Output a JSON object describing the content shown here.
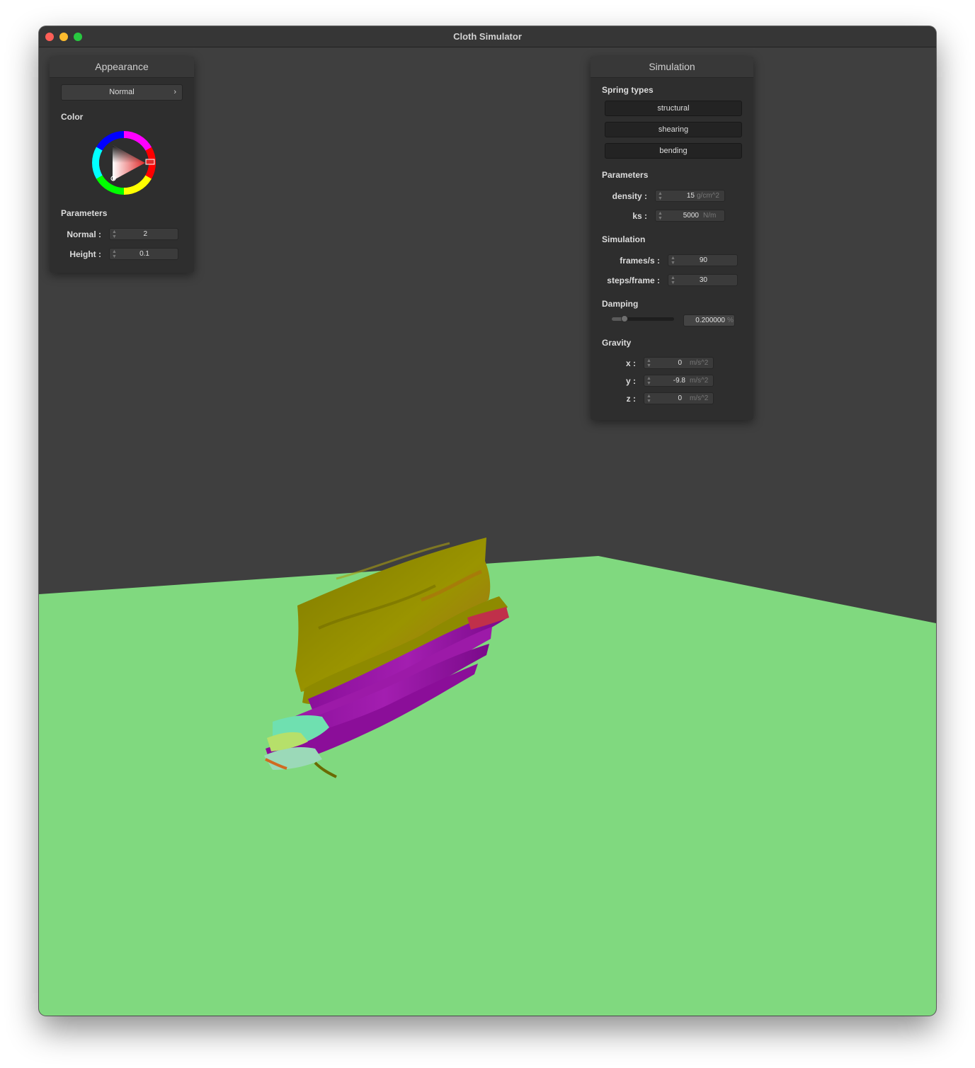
{
  "window": {
    "title": "Cloth Simulator"
  },
  "appearance": {
    "title": "Appearance",
    "shader": "Normal",
    "color_label": "Color",
    "selected_color": "#e02a2a",
    "params_label": "Parameters",
    "normal_label": "Normal :",
    "normal_value": "2",
    "height_label": "Height :",
    "height_value": "0.1"
  },
  "simulation": {
    "title": "Simulation",
    "spring_types_label": "Spring types",
    "spring_types": [
      "structural",
      "shearing",
      "bending"
    ],
    "params_label": "Parameters",
    "density_label": "density :",
    "density_value": "15",
    "density_unit": "g/cm^2",
    "ks_label": "ks :",
    "ks_value": "5000",
    "ks_unit": "N/m",
    "sim_label": "Simulation",
    "fps_label": "frames/s :",
    "fps_value": "90",
    "spf_label": "steps/frame :",
    "spf_value": "30",
    "damping_label": "Damping",
    "damping_value": "0.200000",
    "damping_unit": "%",
    "damping_slider_fraction": 0.2,
    "gravity_label": "Gravity",
    "gx_label": "x :",
    "gx_value": "0",
    "gy_label": "y :",
    "gy_value": "-9.8",
    "gz_label": "z :",
    "gz_value": "0",
    "gravity_unit": "m/s^2"
  },
  "scene": {
    "floor_color": "#80d97f",
    "background_color": "#3f3f3f"
  }
}
